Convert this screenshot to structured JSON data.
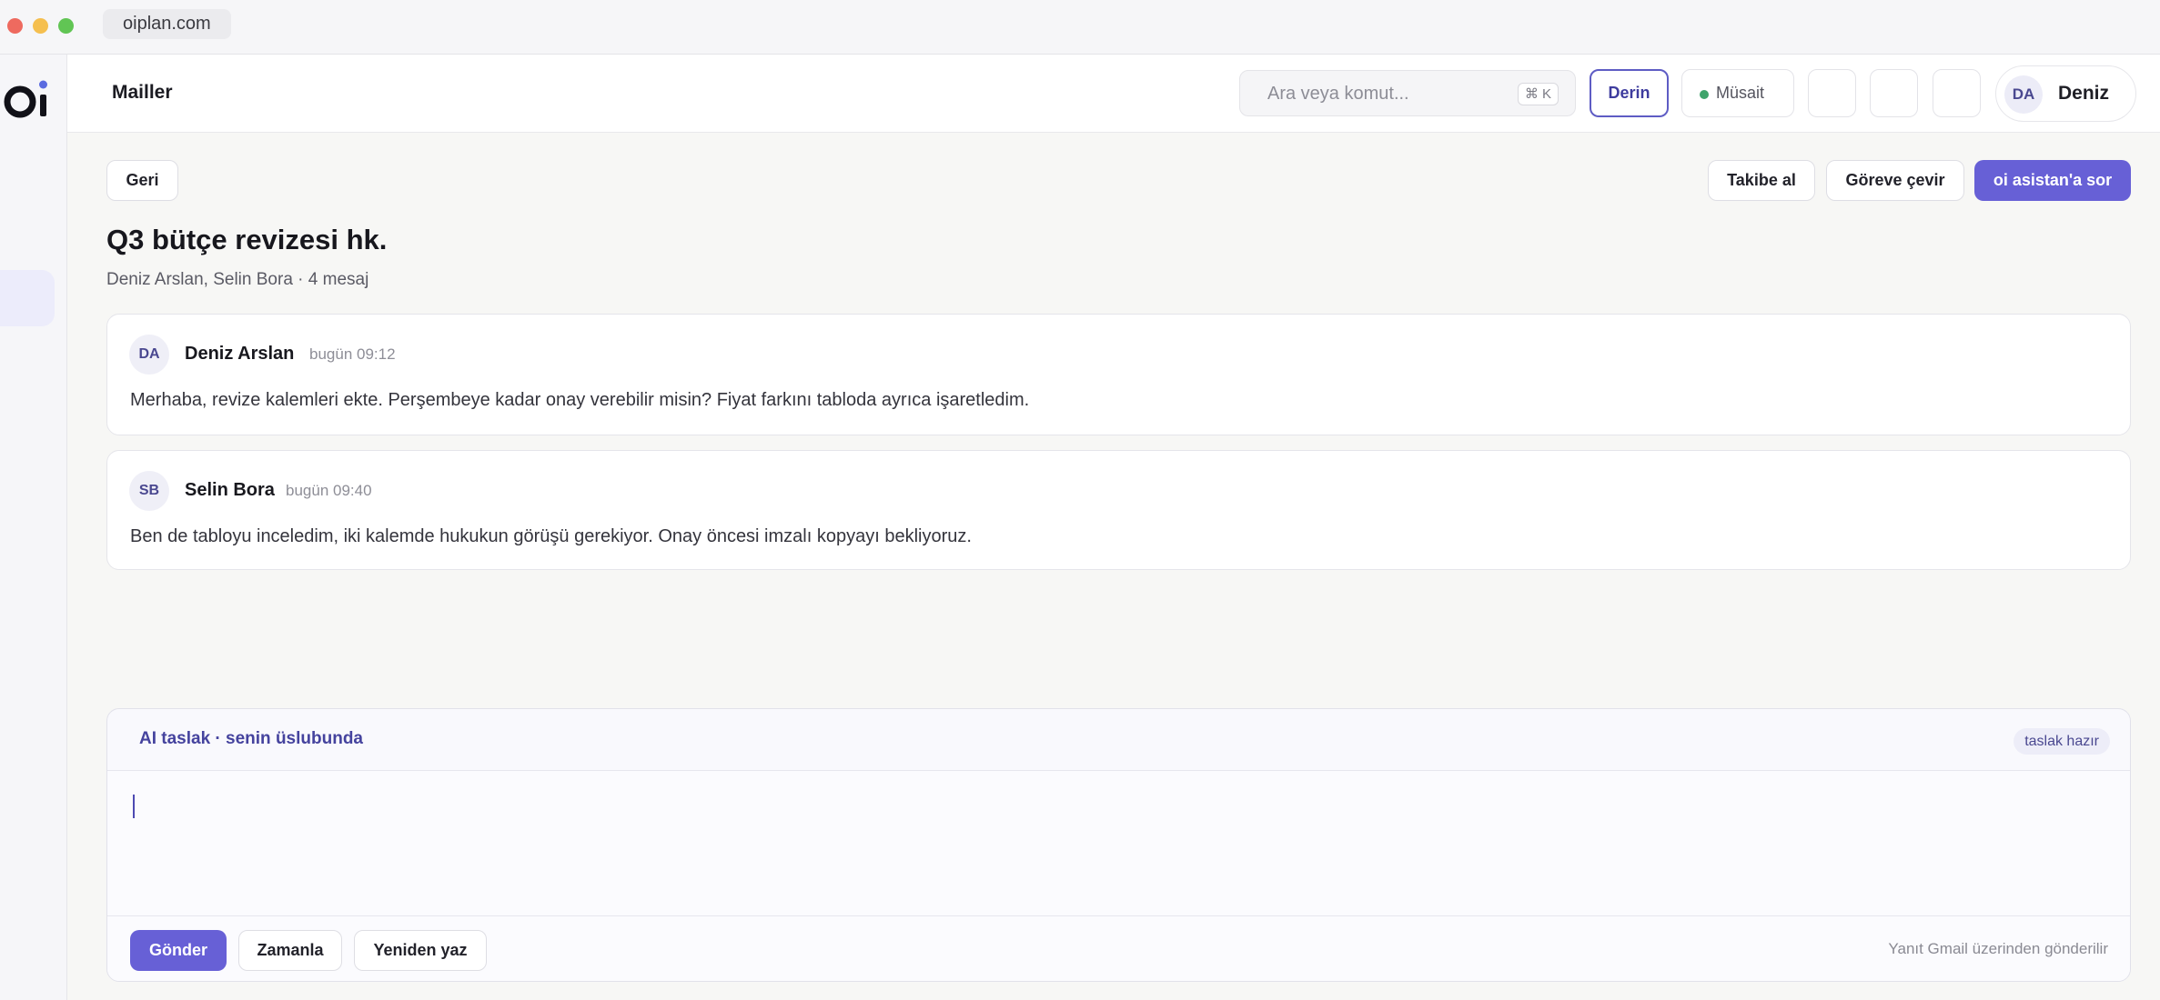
{
  "browser": {
    "url": "oiplan.com"
  },
  "app": {
    "logo_text": "oi",
    "brand_color": "#6760d6"
  },
  "topbar": {
    "page_heading": "Mailler",
    "search": {
      "placeholder": "Ara veya komut...",
      "shortcut": "⌘ K"
    },
    "mode_button": "Derin",
    "status_button": "Müsait",
    "status_color": "#3fa46b",
    "user": {
      "initials": "DA",
      "name": "Deniz"
    }
  },
  "actions": {
    "back": "Geri",
    "follow": "Takibe al",
    "to_task": "Göreve çevir",
    "ask_assistant": "oi asistan'a sor"
  },
  "thread": {
    "title": "Q3 bütçe revizesi hk.",
    "subtitle": "Deniz Arslan, Selin Bora · 4 mesaj",
    "messages": [
      {
        "initials": "DA",
        "sender": "Deniz Arslan",
        "time": "bugün 09:12",
        "body": "Merhaba, revize kalemleri ekte. Perşembeye kadar onay verebilir misin? Fiyat farkını tabloda ayrıca işaretledim."
      },
      {
        "initials": "SB",
        "sender": "Selin Bora",
        "time": "bugün 09:40",
        "body": "Ben de tabloyu inceledim, iki kalemde hukukun görüşü gerekiyor. Onay öncesi imzalı kopyayı bekliyoruz."
      }
    ]
  },
  "composer": {
    "title": "AI taslak · senin üslubunda",
    "badge": "taslak hazır",
    "draft_text": "",
    "send": "Gönder",
    "schedule": "Zamanla",
    "rewrite": "Yeniden yaz",
    "note": "Yanıt Gmail üzerinden gönderilir"
  }
}
